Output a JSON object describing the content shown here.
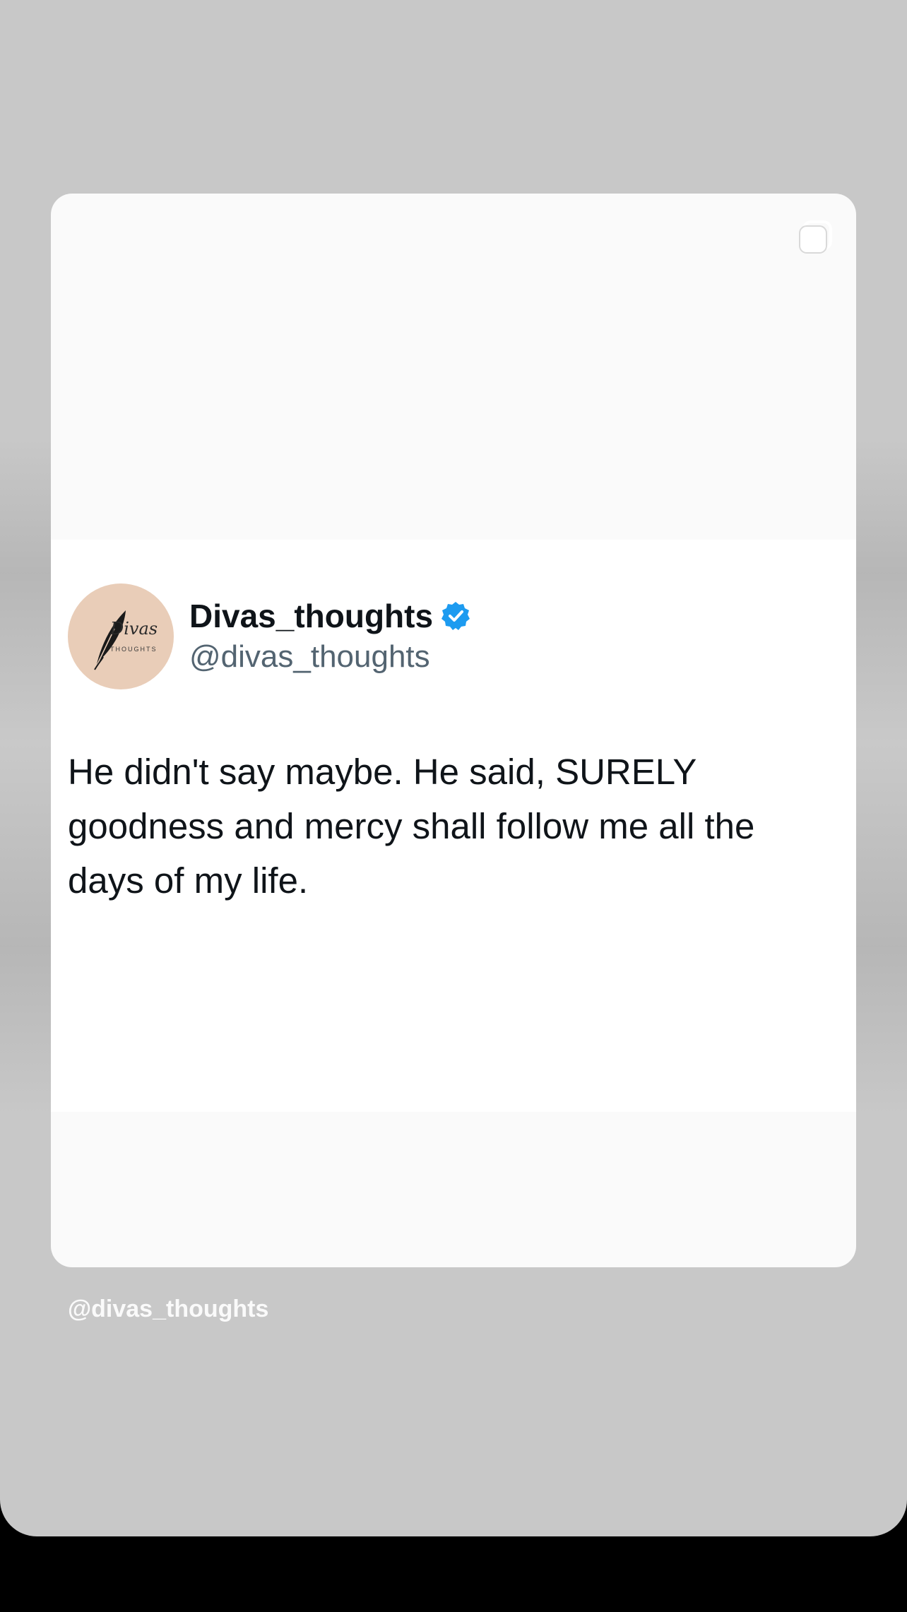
{
  "post": {
    "author_name": "Divas_thoughts",
    "author_handle": "@divas_thoughts",
    "verified": true,
    "text": "He didn't say maybe. He said, SURELY goodness and mercy shall follow me all the days of my life."
  },
  "avatar": {
    "logo_text": "Divas",
    "logo_subtext": "THOUGHTS",
    "background_color": "#e9cdb8"
  },
  "story": {
    "footer_handle": "@divas_thoughts",
    "background_color": "#c8c8c8"
  },
  "icons": {
    "multi_post": "multi-post-icon",
    "verified": "verified-badge-icon"
  },
  "colors": {
    "verified_blue": "#1d9bf0",
    "text_primary": "#0f1419",
    "text_secondary": "#536471"
  }
}
